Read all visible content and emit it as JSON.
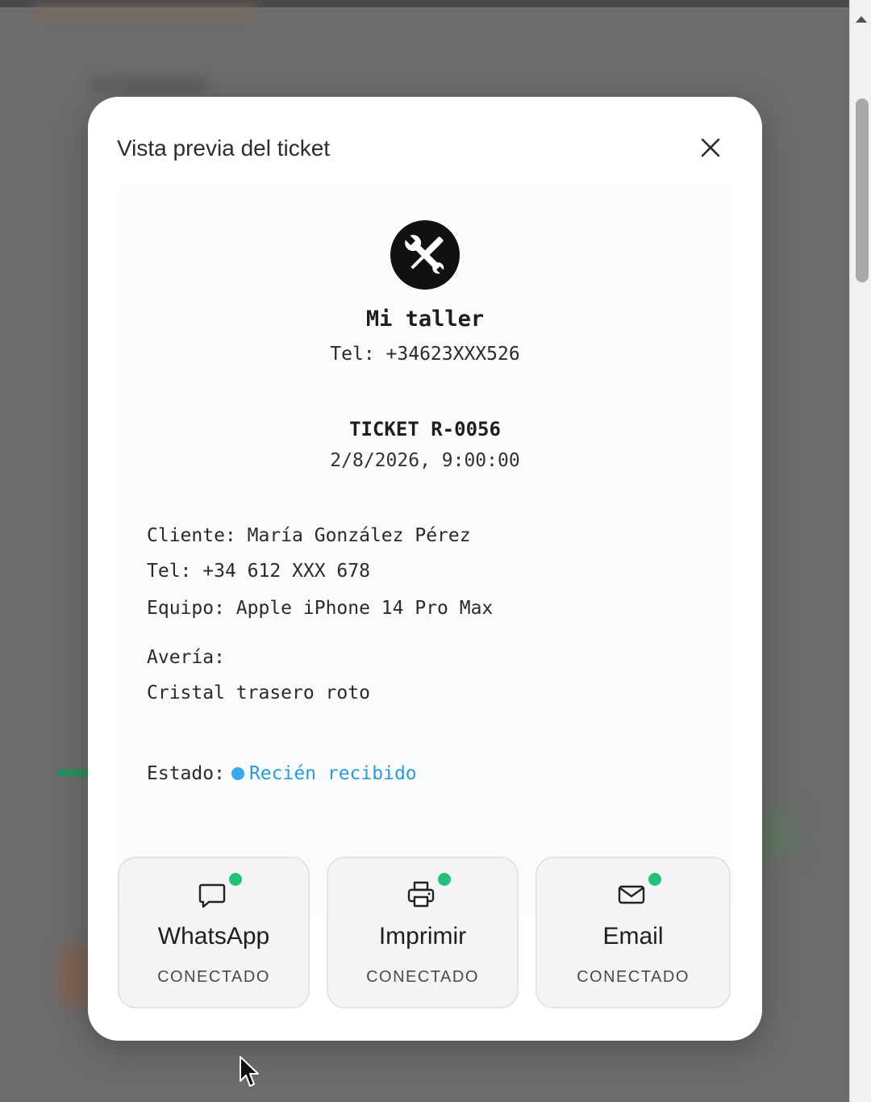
{
  "modal": {
    "title": "Vista previa del ticket",
    "close_icon": "close-icon"
  },
  "ticket": {
    "logo_icon": "tools-icon",
    "shop_name": "Mi taller",
    "shop_tel": "Tel: +34623XXX526",
    "ticket_id": "TICKET R-0056",
    "date": "2/8/2026, 9:00:00",
    "cliente_label": "Cliente:",
    "cliente": "María González Pérez",
    "tel_label": "Tel:",
    "tel": "+34 612 XXX 678",
    "equipo_label": "Equipo:",
    "equipo": "Apple iPhone 14 Pro Max",
    "averia_label": "Avería:",
    "averia": "Cristal trasero roto",
    "estado_label": "Estado:",
    "estado": "Recién recibido",
    "estado_color": "#39a7e8"
  },
  "channels": [
    {
      "name": "WhatsApp",
      "status": "CONECTADO",
      "icon": "chat-icon"
    },
    {
      "name": "Imprimir",
      "status": "CONECTADO",
      "icon": "printer-icon"
    },
    {
      "name": "Email",
      "status": "CONECTADO",
      "icon": "mail-icon"
    }
  ],
  "colors": {
    "connected_dot": "#22c27a",
    "overlay": "#6b6b6b"
  }
}
